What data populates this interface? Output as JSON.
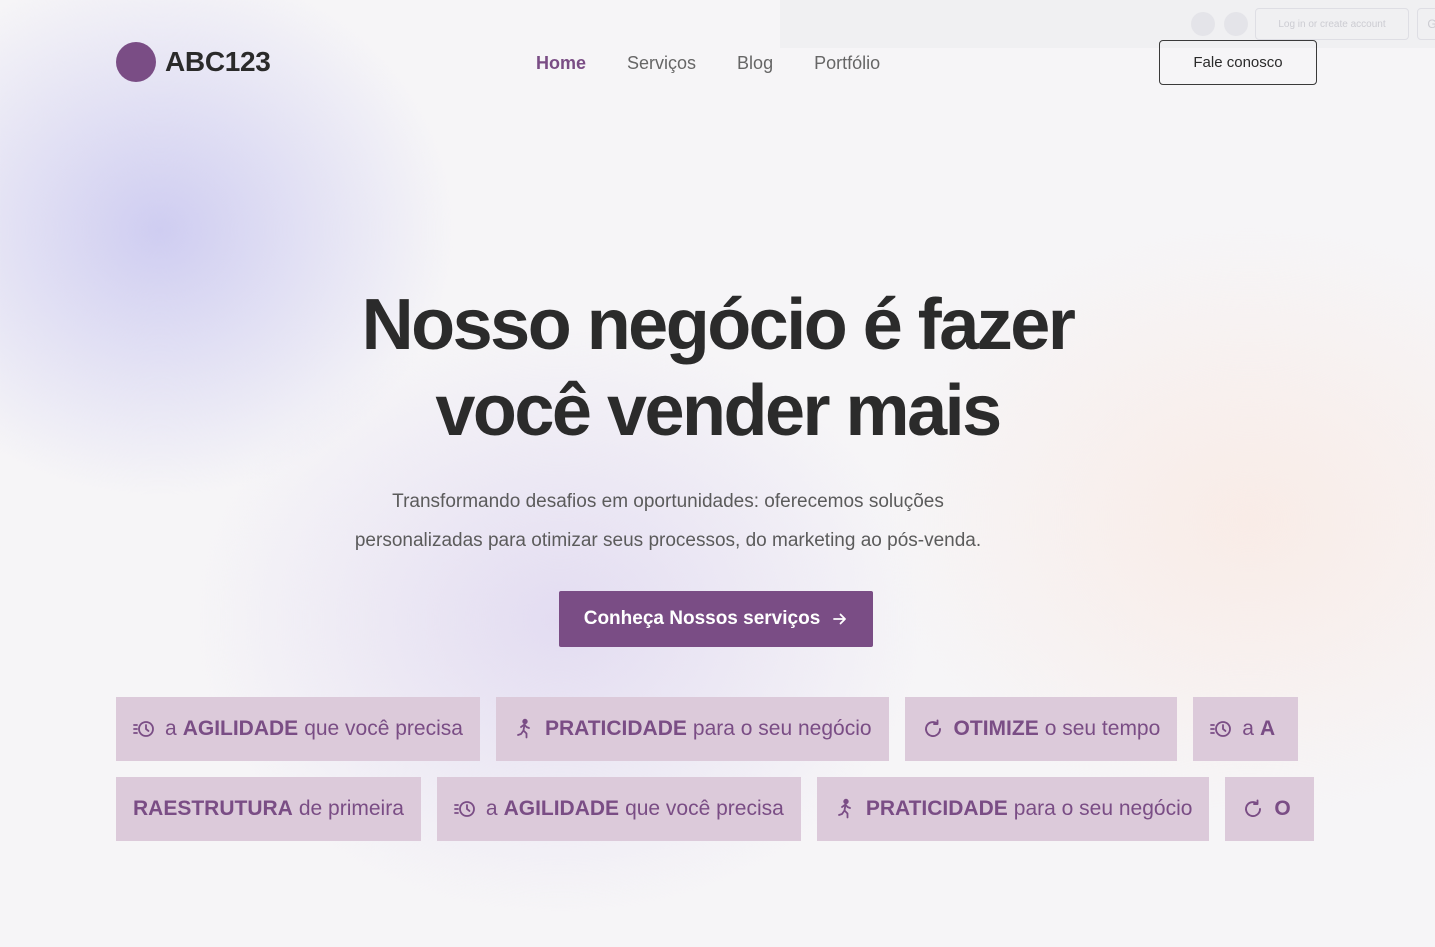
{
  "overlay": {
    "login_text": "Log in or create account",
    "square_glyph": "G"
  },
  "header": {
    "logo_text": "ABC123",
    "nav": [
      {
        "label": "Home",
        "active": true
      },
      {
        "label": "Serviços",
        "active": false
      },
      {
        "label": "Blog",
        "active": false
      },
      {
        "label": "Portfólio",
        "active": false
      }
    ],
    "contact_label": "Fale conosco"
  },
  "hero": {
    "title_line1": "Nosso negócio é fazer",
    "title_line2": "você vender mais",
    "subtitle_line1": "Transformando desafios em oportunidades: oferecemos soluções",
    "subtitle_line2": "personalizadas para otimizar seus processos, do marketing ao pós-venda.",
    "cta_label": "Conheça Nossos serviços",
    "cta_icon": "arrow-right-icon"
  },
  "features": {
    "row1": [
      {
        "icon": "clock-fast-icon",
        "pre": "a",
        "bold": "AGILIDADE",
        "post": "que você precisa"
      },
      {
        "icon": "running-person-icon",
        "pre": "",
        "bold": "PRATICIDADE",
        "post": "para o seu negócio"
      },
      {
        "icon": "refresh-icon",
        "pre": "",
        "bold": "OTIMIZE",
        "post": "o seu tempo"
      },
      {
        "icon": "clock-fast-icon",
        "pre": "a",
        "bold": "A",
        "post": ""
      }
    ],
    "row2": [
      {
        "icon": "",
        "pre": "",
        "bold": "RAESTRUTURA",
        "post": "de primeira"
      },
      {
        "icon": "clock-fast-icon",
        "pre": "a",
        "bold": "AGILIDADE",
        "post": "que você precisa"
      },
      {
        "icon": "running-person-icon",
        "pre": "",
        "bold": "PRATICIDADE",
        "post": "para o seu negócio"
      },
      {
        "icon": "refresh-icon",
        "pre": "",
        "bold": "O",
        "post": ""
      }
    ]
  },
  "colors": {
    "brand": "#7a4d85",
    "chip_bg": "#dccada",
    "text_dark": "#2a2a2a"
  }
}
